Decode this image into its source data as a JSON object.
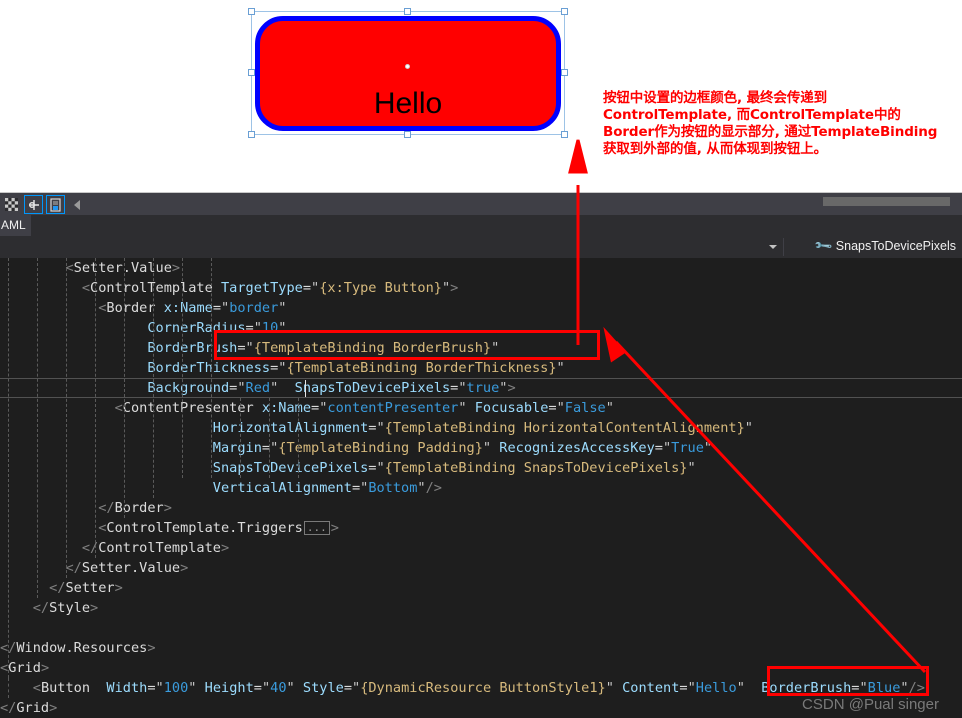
{
  "designer": {
    "button": {
      "label": "Hello",
      "background_color": "#ff0000",
      "border_color": "#0000ff",
      "corner_radius": "10"
    },
    "selection_adorner_color": "#9dc3e6"
  },
  "annotation": {
    "color": "#ff0000",
    "lines": [
      "按钮中设置的边框颜色, 最终会传递到",
      "ControlTemplate, 而ControlTemplate中的",
      "Border作为按钮的显示部分, 通过TemplateBinding",
      "获取到外部的值, 从而体现到按钮上。"
    ]
  },
  "splitter": {
    "buttons": [
      {
        "name": "checkerboard-icon",
        "glyph": "▩"
      },
      {
        "name": "pan-tool-icon",
        "glyph": "✛"
      },
      {
        "name": "copy-xaml-icon",
        "glyph": "⎘"
      }
    ],
    "collapse_glyph": "◀"
  },
  "tabs": [
    {
      "label": "AML",
      "active": true
    }
  ],
  "navbar": {
    "member": "SnapsToDevicePixels",
    "member_icon": "wrench-icon",
    "dropdown_caret": "chevron-down-icon"
  },
  "editor": {
    "background": "#1e1e1e",
    "current_line": 6,
    "lines": [
      {
        "indent": 0,
        "tokens": [
          {
            "c": "pad",
            "t": "        "
          },
          {
            "c": "b",
            "t": "<"
          },
          {
            "c": "e",
            "t": "Setter.Value"
          },
          {
            "c": "b",
            "t": ">"
          }
        ]
      },
      {
        "indent": 0,
        "tokens": [
          {
            "c": "pad",
            "t": "          "
          },
          {
            "c": "b",
            "t": "<"
          },
          {
            "c": "e",
            "t": "ControlTemplate"
          },
          {
            "c": "pad",
            "t": " "
          },
          {
            "c": "a",
            "t": "TargetType"
          },
          {
            "c": "eq",
            "t": "="
          },
          {
            "c": "q",
            "t": "\""
          },
          {
            "c": "m",
            "t": "{x:Type Button}"
          },
          {
            "c": "q",
            "t": "\""
          },
          {
            "c": "b",
            "t": ">"
          }
        ]
      },
      {
        "indent": 0,
        "tokens": [
          {
            "c": "pad",
            "t": "            "
          },
          {
            "c": "b",
            "t": "<"
          },
          {
            "c": "e",
            "t": "Border"
          },
          {
            "c": "pad",
            "t": " "
          },
          {
            "c": "a",
            "t": "x:Name"
          },
          {
            "c": "eq",
            "t": "="
          },
          {
            "c": "q",
            "t": "\""
          },
          {
            "c": "v",
            "t": "border"
          },
          {
            "c": "q",
            "t": "\""
          }
        ]
      },
      {
        "indent": 0,
        "tokens": [
          {
            "c": "pad",
            "t": "                  "
          },
          {
            "c": "a",
            "t": "CornerRadius"
          },
          {
            "c": "eq",
            "t": "="
          },
          {
            "c": "q",
            "t": "\""
          },
          {
            "c": "v",
            "t": "10"
          },
          {
            "c": "q",
            "t": "\""
          }
        ]
      },
      {
        "indent": 0,
        "tokens": [
          {
            "c": "pad",
            "t": "                  "
          },
          {
            "c": "a",
            "t": "BorderBrush"
          },
          {
            "c": "eq",
            "t": "="
          },
          {
            "c": "q",
            "t": "\""
          },
          {
            "c": "m",
            "t": "{TemplateBinding BorderBrush}"
          },
          {
            "c": "q",
            "t": "\""
          }
        ]
      },
      {
        "indent": 0,
        "tokens": [
          {
            "c": "pad",
            "t": "                  "
          },
          {
            "c": "a",
            "t": "BorderThickness"
          },
          {
            "c": "eq",
            "t": "="
          },
          {
            "c": "q",
            "t": "\""
          },
          {
            "c": "m",
            "t": "{TemplateBinding BorderThickness}"
          },
          {
            "c": "q",
            "t": "\""
          }
        ]
      },
      {
        "indent": 0,
        "tokens": [
          {
            "c": "pad",
            "t": "                  "
          },
          {
            "c": "a",
            "t": "Background"
          },
          {
            "c": "eq",
            "t": "="
          },
          {
            "c": "q",
            "t": "\""
          },
          {
            "c": "v",
            "t": "Red"
          },
          {
            "c": "q",
            "t": "\""
          },
          {
            "c": "pad",
            "t": "  "
          },
          {
            "c": "a",
            "t": "SnapsToDevicePixels"
          },
          {
            "c": "eq",
            "t": "="
          },
          {
            "c": "q",
            "t": "\""
          },
          {
            "c": "v",
            "t": "true"
          },
          {
            "c": "q",
            "t": "\""
          },
          {
            "c": "b",
            "t": ">"
          }
        ]
      },
      {
        "indent": 0,
        "tokens": [
          {
            "c": "pad",
            "t": "              "
          },
          {
            "c": "b",
            "t": "<"
          },
          {
            "c": "e",
            "t": "ContentPresenter"
          },
          {
            "c": "pad",
            "t": " "
          },
          {
            "c": "a",
            "t": "x:Name"
          },
          {
            "c": "eq",
            "t": "="
          },
          {
            "c": "q",
            "t": "\""
          },
          {
            "c": "v",
            "t": "contentPresenter"
          },
          {
            "c": "q",
            "t": "\""
          },
          {
            "c": "pad",
            "t": " "
          },
          {
            "c": "a",
            "t": "Focusable"
          },
          {
            "c": "eq",
            "t": "="
          },
          {
            "c": "q",
            "t": "\""
          },
          {
            "c": "v",
            "t": "False"
          },
          {
            "c": "q",
            "t": "\""
          }
        ]
      },
      {
        "indent": 0,
        "tokens": [
          {
            "c": "pad",
            "t": "                          "
          },
          {
            "c": "a",
            "t": "HorizontalAlignment"
          },
          {
            "c": "eq",
            "t": "="
          },
          {
            "c": "q",
            "t": "\""
          },
          {
            "c": "m",
            "t": "{TemplateBinding HorizontalContentAlignment}"
          },
          {
            "c": "q",
            "t": "\""
          }
        ]
      },
      {
        "indent": 0,
        "tokens": [
          {
            "c": "pad",
            "t": "                          "
          },
          {
            "c": "a",
            "t": "Margin"
          },
          {
            "c": "eq",
            "t": "="
          },
          {
            "c": "q",
            "t": "\""
          },
          {
            "c": "m",
            "t": "{TemplateBinding Padding}"
          },
          {
            "c": "q",
            "t": "\""
          },
          {
            "c": "pad",
            "t": " "
          },
          {
            "c": "a",
            "t": "RecognizesAccessKey"
          },
          {
            "c": "eq",
            "t": "="
          },
          {
            "c": "q",
            "t": "\""
          },
          {
            "c": "v",
            "t": "True"
          },
          {
            "c": "q",
            "t": "\""
          }
        ]
      },
      {
        "indent": 0,
        "tokens": [
          {
            "c": "pad",
            "t": "                          "
          },
          {
            "c": "a",
            "t": "SnapsToDevicePixels"
          },
          {
            "c": "eq",
            "t": "="
          },
          {
            "c": "q",
            "t": "\""
          },
          {
            "c": "m",
            "t": "{TemplateBinding SnapsToDevicePixels}"
          },
          {
            "c": "q",
            "t": "\""
          }
        ]
      },
      {
        "indent": 0,
        "tokens": [
          {
            "c": "pad",
            "t": "                          "
          },
          {
            "c": "a",
            "t": "VerticalAlignment"
          },
          {
            "c": "eq",
            "t": "="
          },
          {
            "c": "q",
            "t": "\""
          },
          {
            "c": "v",
            "t": "Bottom"
          },
          {
            "c": "q",
            "t": "\""
          },
          {
            "c": "b",
            "t": "/>"
          }
        ]
      },
      {
        "indent": 0,
        "tokens": [
          {
            "c": "pad",
            "t": "            "
          },
          {
            "c": "b",
            "t": "</"
          },
          {
            "c": "e",
            "t": "Border"
          },
          {
            "c": "b",
            "t": ">"
          }
        ]
      },
      {
        "indent": 0,
        "tokens": [
          {
            "c": "pad",
            "t": "            "
          },
          {
            "c": "b",
            "t": "<"
          },
          {
            "c": "e",
            "t": "ControlTemplate.Triggers"
          },
          {
            "c": "fold",
            "t": "..."
          },
          {
            "c": "b",
            "t": ">"
          }
        ]
      },
      {
        "indent": 0,
        "tokens": [
          {
            "c": "pad",
            "t": "          "
          },
          {
            "c": "b",
            "t": "</"
          },
          {
            "c": "e",
            "t": "ControlTemplate"
          },
          {
            "c": "b",
            "t": ">"
          }
        ]
      },
      {
        "indent": 0,
        "tokens": [
          {
            "c": "pad",
            "t": "        "
          },
          {
            "c": "b",
            "t": "</"
          },
          {
            "c": "e",
            "t": "Setter.Value"
          },
          {
            "c": "b",
            "t": ">"
          }
        ]
      },
      {
        "indent": 0,
        "tokens": [
          {
            "c": "pad",
            "t": "      "
          },
          {
            "c": "b",
            "t": "</"
          },
          {
            "c": "e",
            "t": "Setter"
          },
          {
            "c": "b",
            "t": ">"
          }
        ]
      },
      {
        "indent": 0,
        "tokens": [
          {
            "c": "pad",
            "t": "    "
          },
          {
            "c": "b",
            "t": "</"
          },
          {
            "c": "e",
            "t": "Style"
          },
          {
            "c": "b",
            "t": ">"
          }
        ]
      },
      {
        "indent": 0,
        "tokens": []
      },
      {
        "indent": 0,
        "tokens": [
          {
            "c": "b",
            "t": "</"
          },
          {
            "c": "e",
            "t": "Window.Resources"
          },
          {
            "c": "b",
            "t": ">"
          }
        ]
      },
      {
        "indent": 0,
        "tokens": [
          {
            "c": "b",
            "t": "<"
          },
          {
            "c": "e",
            "t": "Grid"
          },
          {
            "c": "b",
            "t": ">"
          }
        ]
      },
      {
        "indent": 0,
        "tokens": [
          {
            "c": "pad",
            "t": "    "
          },
          {
            "c": "b",
            "t": "<"
          },
          {
            "c": "e",
            "t": "Button"
          },
          {
            "c": "pad",
            "t": "  "
          },
          {
            "c": "a",
            "t": "Width"
          },
          {
            "c": "eq",
            "t": "="
          },
          {
            "c": "q",
            "t": "\""
          },
          {
            "c": "v",
            "t": "100"
          },
          {
            "c": "q",
            "t": "\""
          },
          {
            "c": "pad",
            "t": " "
          },
          {
            "c": "a",
            "t": "Height"
          },
          {
            "c": "eq",
            "t": "="
          },
          {
            "c": "q",
            "t": "\""
          },
          {
            "c": "v",
            "t": "40"
          },
          {
            "c": "q",
            "t": "\""
          },
          {
            "c": "pad",
            "t": " "
          },
          {
            "c": "a",
            "t": "Style"
          },
          {
            "c": "eq",
            "t": "="
          },
          {
            "c": "q",
            "t": "\""
          },
          {
            "c": "m",
            "t": "{DynamicResource ButtonStyle1}"
          },
          {
            "c": "q",
            "t": "\""
          },
          {
            "c": "pad",
            "t": " "
          },
          {
            "c": "a",
            "t": "Content"
          },
          {
            "c": "eq",
            "t": "="
          },
          {
            "c": "q",
            "t": "\""
          },
          {
            "c": "v",
            "t": "Hello"
          },
          {
            "c": "q",
            "t": "\""
          },
          {
            "c": "pad",
            "t": "  "
          },
          {
            "c": "a",
            "t": "BorderBrush"
          },
          {
            "c": "eq",
            "t": "="
          },
          {
            "c": "q",
            "t": "\""
          },
          {
            "c": "v",
            "t": "Blue"
          },
          {
            "c": "q",
            "t": "\""
          },
          {
            "c": "b",
            "t": "/>"
          }
        ]
      },
      {
        "indent": 0,
        "tokens": [
          {
            "c": "b",
            "t": "</"
          },
          {
            "c": "e",
            "t": "Grid"
          },
          {
            "c": "b",
            "t": ">"
          }
        ]
      }
    ]
  },
  "callouts": [
    {
      "name": "borderbrush-template-binding",
      "color": "#ff0000"
    },
    {
      "name": "borderbrush-blue",
      "color": "#ff0000"
    }
  ],
  "watermark": "CSDN @Pual singer"
}
